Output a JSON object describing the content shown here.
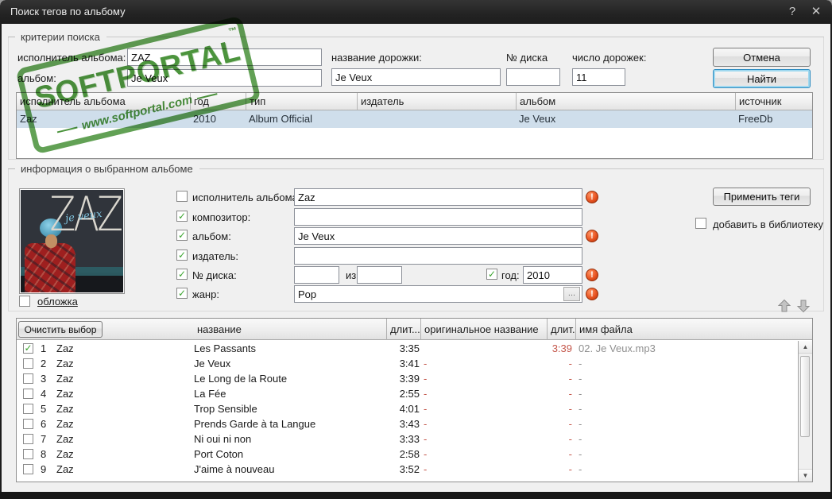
{
  "window": {
    "title": "Поиск тегов по альбому"
  },
  "icons": {
    "help": "?",
    "close": "✕",
    "warning": "!",
    "check": "✓",
    "browse": "...",
    "scroll_up": "▲",
    "scroll_down": "▼"
  },
  "watermark": {
    "brand": "SOFTPORTAL",
    "tm": "™",
    "url": "www.softportal.com"
  },
  "search_criteria": {
    "group_title": "критерии поиска",
    "album_artist_label": "исполнитель альбома:",
    "album_artist_value": "ZAZ",
    "album_label": "альбом:",
    "album_value": "Je Veux",
    "track_title_label": "название дорожки:",
    "track_title_value": "Je Veux",
    "disc_label": "№ диска",
    "disc_value": "",
    "track_count_label": "число дорожек:",
    "track_count_value": "11",
    "cancel_button": "Отмена",
    "find_button": "Найти"
  },
  "results_table": {
    "columns": [
      "исполнитель альбома",
      "год",
      "тип",
      "издатель",
      "альбом",
      "источник"
    ],
    "row": {
      "artist": "Zaz",
      "year": "2010",
      "type": "Album Official",
      "publisher": "",
      "album": "Je Veux",
      "source": "FreeDb"
    }
  },
  "album_info": {
    "group_title": "информация о выбранном альбоме",
    "cover_label": "обложка",
    "cover_art": {
      "brand": "ZAZ",
      "script": "je veux"
    },
    "artist_label": "исполнитель альбома:",
    "artist_value": "Zaz",
    "composer_label": "композитор:",
    "composer_value": "",
    "album_label": "альбом:",
    "album_value": "Je Veux",
    "publisher_label": "издатель:",
    "publisher_value": "",
    "disc_label": "№ диска:",
    "disc_value": "",
    "disc_of_label": "из",
    "disc_total_value": "",
    "year_label": "год:",
    "year_value": "2010",
    "genre_label": "жанр:",
    "genre_value": "Pop",
    "apply_button": "Применить теги",
    "add_to_library_label": "добавить в библиотеку"
  },
  "track_table": {
    "clear_button": "Очистить выбор",
    "columns": {
      "title": "название",
      "duration": "длит...",
      "original_title": "оригинальное название",
      "duration2": "длит...",
      "filename": "имя файла"
    },
    "rows": [
      {
        "num": "1",
        "checked": true,
        "artist": "Zaz",
        "title": "Les Passants",
        "duration": "3:35",
        "original": "",
        "duration2": "3:39",
        "filename": "02. Je Veux.mp3"
      },
      {
        "num": "2",
        "checked": false,
        "artist": "Zaz",
        "title": "Je Veux",
        "duration": "3:41",
        "original": "-",
        "duration2": "-",
        "filename": "-"
      },
      {
        "num": "3",
        "checked": false,
        "artist": "Zaz",
        "title": "Le Long de la Route",
        "duration": "3:39",
        "original": "-",
        "duration2": "-",
        "filename": "-"
      },
      {
        "num": "4",
        "checked": false,
        "artist": "Zaz",
        "title": "La Fée",
        "duration": "2:55",
        "original": "-",
        "duration2": "-",
        "filename": "-"
      },
      {
        "num": "5",
        "checked": false,
        "artist": "Zaz",
        "title": "Trop Sensible",
        "duration": "4:01",
        "original": "-",
        "duration2": "-",
        "filename": "-"
      },
      {
        "num": "6",
        "checked": false,
        "artist": "Zaz",
        "title": "Prends Garde à ta Langue",
        "duration": "3:43",
        "original": "-",
        "duration2": "-",
        "filename": "-"
      },
      {
        "num": "7",
        "checked": false,
        "artist": "Zaz",
        "title": "Ni oui ni non",
        "duration": "3:33",
        "original": "-",
        "duration2": "-",
        "filename": "-"
      },
      {
        "num": "8",
        "checked": false,
        "artist": "Zaz",
        "title": "Port Coton",
        "duration": "2:58",
        "original": "-",
        "duration2": "-",
        "filename": "-"
      },
      {
        "num": "9",
        "checked": false,
        "artist": "Zaz",
        "title": "J'aime à nouveau",
        "duration": "3:52",
        "original": "-",
        "duration2": "-",
        "filename": "-"
      }
    ]
  }
}
